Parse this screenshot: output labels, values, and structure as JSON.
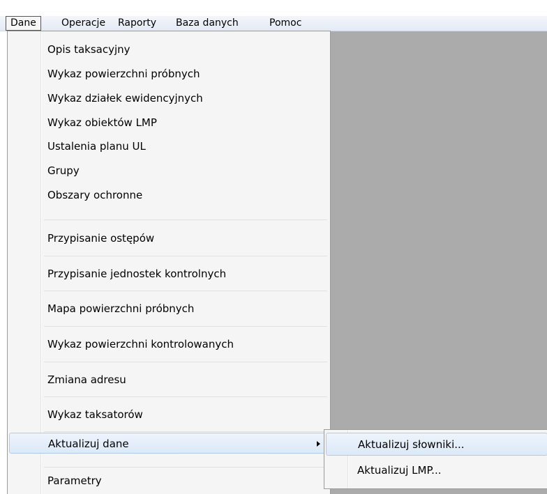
{
  "menubar": {
    "items": [
      {
        "label": "Dane"
      },
      {
        "label": "Operacje"
      },
      {
        "label": "Raporty"
      },
      {
        "label": "Baza danych"
      },
      {
        "label": "Pomoc"
      }
    ]
  },
  "dropdown": {
    "items": [
      {
        "label": "Opis taksacyjny"
      },
      {
        "label": "Wykaz powierzchni próbnych"
      },
      {
        "label": "Wykaz działek ewidencyjnych"
      },
      {
        "label": "Wykaz obiektów LMP"
      },
      {
        "label": "Ustalenia planu UL"
      },
      {
        "label": "Grupy"
      },
      {
        "label": "Obszary ochronne"
      },
      {
        "label": "Przypisanie ostępów"
      },
      {
        "label": "Przypisanie jednostek kontrolnych"
      },
      {
        "label": "Mapa powierzchni próbnych"
      },
      {
        "label": "Wykaz powierzchni kontrolowanych"
      },
      {
        "label": "Zmiana adresu"
      },
      {
        "label": "Wykaz taksatorów"
      },
      {
        "label": "Aktualizuj dane"
      },
      {
        "label": "Parametry"
      }
    ]
  },
  "submenu": {
    "items": [
      {
        "label": "Aktualizuj słowniki..."
      },
      {
        "label": "Aktualizuj LMP..."
      }
    ]
  }
}
